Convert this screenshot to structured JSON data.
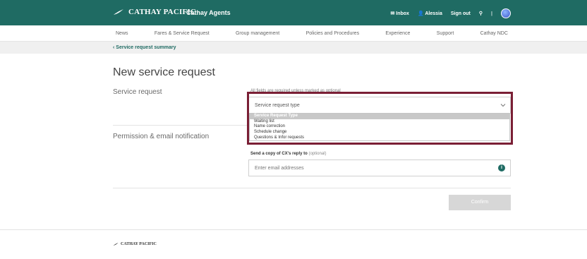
{
  "header": {
    "brand": "CATHAY PACIFIC",
    "app_name": "Cathay Agents",
    "inbox": "Inbox",
    "user": "Alessia",
    "signout": "Sign out",
    "divider": "|"
  },
  "nav": {
    "items": [
      "News",
      "Fares & Service Request",
      "Group management",
      "Policies and Procedures",
      "Experience",
      "Support",
      "Cathay NDC"
    ]
  },
  "breadcrumb": "Service request summary",
  "page": {
    "title": "New service request",
    "service_request_label": "Service request",
    "required_note": "All fields are required unless marked as optional",
    "select_placeholder": "Service request type",
    "dropdown_options": [
      "Service Request Type",
      "Waiting list",
      "Name correction",
      "Schedule change",
      "Questions & Infor requests"
    ],
    "permission_label": "Permission & email notification",
    "copy_label": "Send a copy of CX's reply to",
    "copy_optional": "(optional)",
    "email_placeholder": "Enter email addresses",
    "confirm": "Confirm"
  },
  "footer": {
    "brand": "CATHAY PACIFIC"
  },
  "colors": {
    "brand_teal": "#1f6b63",
    "highlight": "#7a1f35"
  }
}
